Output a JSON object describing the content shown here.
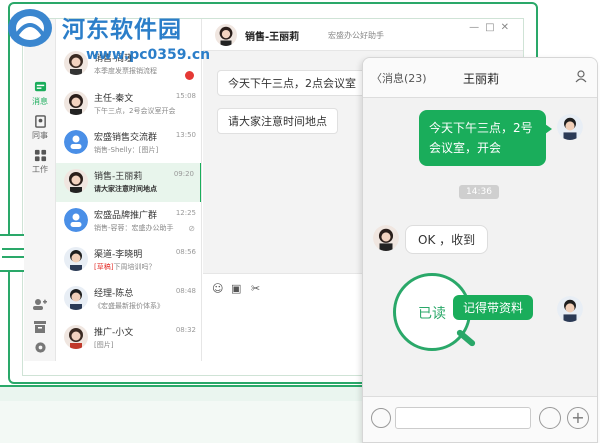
{
  "watermark": {
    "site": "河东软件园",
    "url": "www.pc0359.cn"
  },
  "nav": {
    "items": [
      {
        "label": "消息",
        "icon": "chat-bubble-icon",
        "active": true
      },
      {
        "label": "同事",
        "icon": "contacts-icon",
        "active": false
      },
      {
        "label": "工作",
        "icon": "apps-grid-icon",
        "active": false
      }
    ]
  },
  "conversations": [
    {
      "name": "销售-周瑾",
      "preview": "本季度发票报销流程",
      "time": "",
      "unread": true,
      "avatar": "female"
    },
    {
      "name": "主任-秦文",
      "preview": "下午三点，2号会议室开会",
      "time": "15:08",
      "avatar": "female"
    },
    {
      "name": "宏盛销售交流群",
      "preview": "销售-Shelly：[图片]",
      "time": "13:50",
      "avatar": "group"
    },
    {
      "name": "销售-王丽莉",
      "preview": "请大家注意时间地点",
      "time": "09:20",
      "avatar": "female",
      "active": true
    },
    {
      "name": "宏盛品牌推广群",
      "preview": "销售-容蓉：宏盛办公助手",
      "time": "12:25",
      "avatar": "group",
      "muted": true
    },
    {
      "name": "渠道-李晓明",
      "tag": "[草稿]",
      "preview": "下周培训吗？",
      "time": "08:56",
      "avatar": "male"
    },
    {
      "name": "经理-陈总",
      "preview": "《宏盛最新报价体系》",
      "time": "08:48",
      "avatar": "male"
    },
    {
      "name": "推广-小文",
      "preview": "[图片]",
      "time": "08:32",
      "avatar": "female"
    }
  ],
  "chat": {
    "title": "销售-王丽莉",
    "subtitle": "宏盛办公好助手",
    "messages": [
      {
        "text": "今天下午三点，2点会议室"
      },
      {
        "text": "请大家注意时间地点"
      }
    ],
    "toolbar_icons": [
      "emoji-icon",
      "folder-icon",
      "scissors-icon"
    ]
  },
  "phone": {
    "back_label": "消息(23)",
    "title": "王丽莉",
    "msg_out": "今天下午三点，2号会议室，开会",
    "time_sep": "14:36",
    "msg_in": "OK ，收到",
    "read_label": "已读",
    "msg_out2": "记得带资料"
  },
  "colors": {
    "accent": "#1aad5b",
    "brand_green": "#2aa869",
    "unread": "#e53935",
    "watermark": "#2b7ec9"
  }
}
